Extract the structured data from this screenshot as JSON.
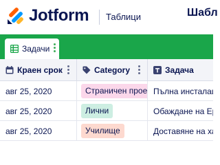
{
  "header": {
    "brand": "Jotform",
    "product": "Таблици",
    "page_title_partial": "Шабл"
  },
  "tabs": [
    {
      "label": "Задачи",
      "icon": "table-grid-icon"
    }
  ],
  "columns": [
    {
      "label": "Краен срок",
      "icon": "calendar-icon"
    },
    {
      "label": "Category",
      "icon": "tag-icon"
    },
    {
      "label": "Задача",
      "icon": "text-icon"
    }
  ],
  "rows": [
    {
      "due": "авг 25, 2020",
      "category": "Страничен проект",
      "category_color": "#fbd7ea",
      "task": "Пълна инсталация"
    },
    {
      "due": "авг 25, 2020",
      "category": "Лични",
      "category_color": "#cdeee2",
      "task": "Обаждане на Ерика"
    },
    {
      "due": "авг 25, 2020",
      "category": "Училище",
      "category_color": "#fdd9cf",
      "task": "Доставяне на харт"
    }
  ],
  "colors": {
    "tab_bar": "#1aa64a",
    "text": "#0a1551",
    "logo_orange": "#ff6100",
    "logo_yellow": "#ffb629",
    "logo_blue": "#0099ff"
  }
}
